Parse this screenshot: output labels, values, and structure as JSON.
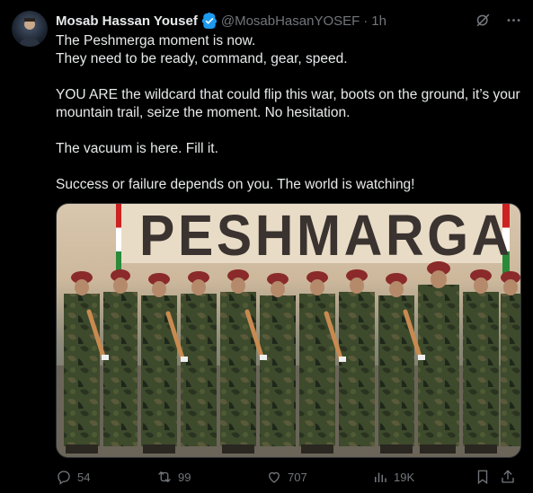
{
  "author": {
    "name": "Mosab Hassan Yousef",
    "handle": "@MosabHasanYOSEF",
    "separator": "·",
    "time": "1h",
    "verified_color": "#1d9bf0"
  },
  "tweet": {
    "lines": [
      "The Peshmerga moment is now.",
      "They need to be ready, command, gear, speed.",
      "",
      "YOU ARE the wildcard that could flip this war, boots on the ground, it’s your mountain trail, seize the moment. No hesitation.",
      "",
      "The vacuum is here. Fill it.",
      "",
      "Success or failure depends on you. The world is watching!"
    ]
  },
  "media": {
    "banner_text": "PESHMARGA"
  },
  "actions": {
    "replies": "54",
    "reposts": "99",
    "likes": "707",
    "views": "19K"
  },
  "icons": [
    "grok-icon",
    "more-icon",
    "reply-icon",
    "repost-icon",
    "like-icon",
    "views-icon",
    "bookmark-icon",
    "share-icon",
    "verified-icon"
  ],
  "colors": {
    "background": "#000000",
    "text": "#e7e9ea",
    "muted": "#71767b",
    "accent": "#1d9bf0"
  }
}
